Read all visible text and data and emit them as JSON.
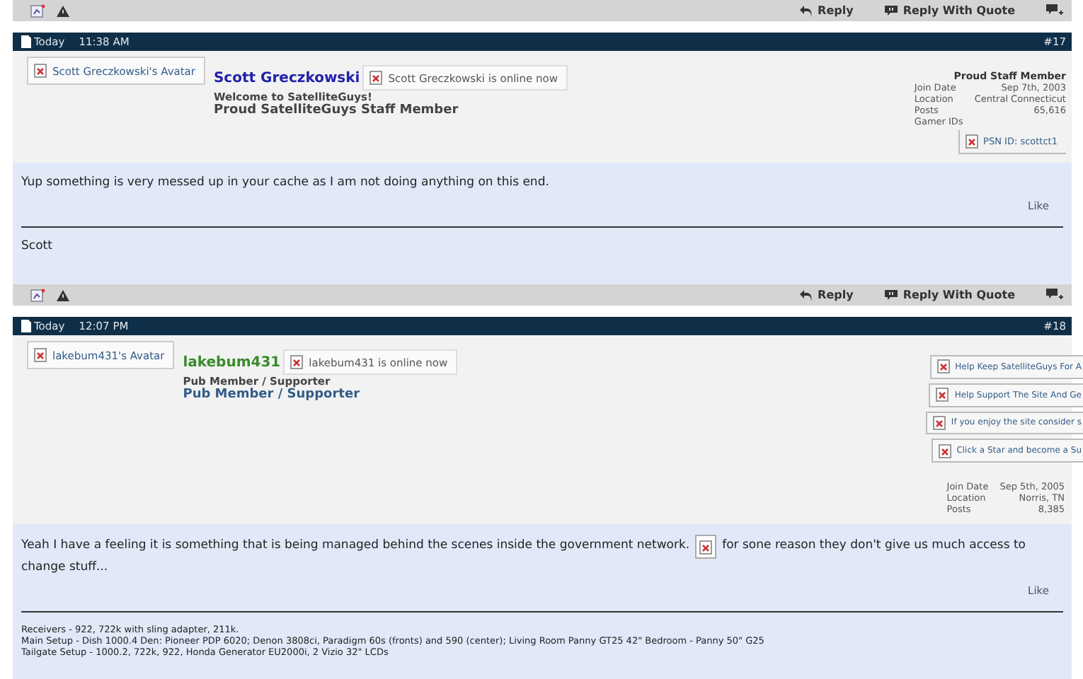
{
  "top_action_bar": {
    "buttons": [
      {
        "label": "Reply"
      },
      {
        "label": "Reply With Quote"
      }
    ]
  },
  "posts": [
    {
      "date": "Today",
      "time": "11:38 AM",
      "number": "#17",
      "avatar_alt": "Scott Greczkowski's Avatar",
      "username": "Scott Greczkowski",
      "online_text": "Scott Greczkowski is online now",
      "user_title": "Welcome to SatelliteGuys!",
      "rank": "Proud SatelliteGuys Staff Member",
      "staff_title": "Proud Staff Member",
      "stats": [
        {
          "label": "Join Date",
          "value": "Sep 7th, 2003"
        },
        {
          "label": "Location",
          "value": "Central Connecticut"
        },
        {
          "label": "Posts",
          "value": "65,616"
        }
      ],
      "gamer_ids_label": "Gamer IDs",
      "gamer_id": "PSN ID: scottct1",
      "message_before": "Yup something is very messed up in your cache as I am not doing anything on this end.",
      "inline_image": false,
      "like": "Like",
      "signature": [
        "Scott"
      ],
      "action_bar": {
        "buttons": [
          {
            "label": "Reply"
          },
          {
            "label": "Reply With Quote"
          }
        ]
      }
    },
    {
      "date": "Today",
      "time": "12:07 PM",
      "number": "#18",
      "avatar_alt": "lakebum431's Avatar",
      "username": "lakebum431",
      "online_text": "lakebum431 is online now",
      "user_title": "Pub Member / Supporter",
      "rank": "Pub Member / Supporter",
      "banners": [
        "Help Keep SatelliteGuys For A",
        "Help Support The Site And Ge",
        "If you enjoy the site consider s",
        "Click a Star and become a Su"
      ],
      "stats": [
        {
          "label": "Join Date",
          "value": "Sep 5th, 2005"
        },
        {
          "label": "Location",
          "value": "Norris, TN"
        },
        {
          "label": "Posts",
          "value": "8,385"
        }
      ],
      "message_before": "Yeah I have a feeling it is something that is being managed behind the scenes inside the government network.",
      "inline_image": true,
      "message_after": "for sone reason they don't give us much access to change stuff...",
      "like": "Like",
      "signature": [
        "Receivers - 922, 722k with sling adapter, 211k.",
        "Main Setup - Dish 1000.4 Den: Pioneer PDP 6020; Denon 3808ci, Paradigm 60s (fronts) and 590 (center); Living Room Panny GT25 42\" Bedroom - Panny 50\" G25",
        "Tailgate Setup - 1000.2, 722k, 922, Honda Generator EU2000i, 2 Vizio 32\" LCDs"
      ]
    }
  ]
}
